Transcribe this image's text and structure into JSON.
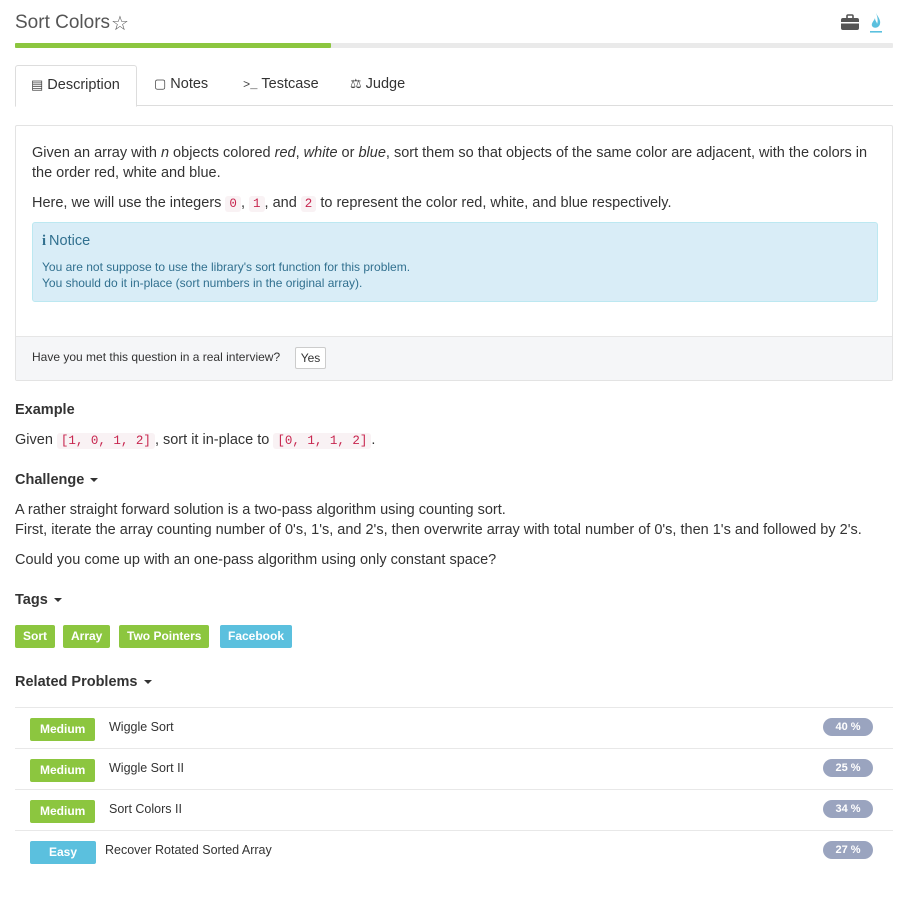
{
  "header": {
    "title": "Sort Colors",
    "progress_percent": 36
  },
  "tabs": [
    {
      "label": "Description",
      "icon": "document-icon",
      "active": true
    },
    {
      "label": "Notes",
      "icon": "note-icon",
      "active": false
    },
    {
      "label": "Testcase",
      "icon": "terminal-icon",
      "active": false
    },
    {
      "label": "Judge",
      "icon": "scales-icon",
      "active": false
    }
  ],
  "description": {
    "p1_a": "Given an array with ",
    "p1_n": "n",
    "p1_b": " objects colored ",
    "p1_red": "red",
    "p1_c": ", ",
    "p1_white": "white",
    "p1_d": " or ",
    "p1_blue": "blue",
    "p1_e": ", sort them so that objects of the same color are adjacent, with the colors in the order red, white and blue.",
    "p2_a": "Here, we will use the integers ",
    "p2_code0": "0",
    "p2_sep1": ", ",
    "p2_code1": "1",
    "p2_sep2": ", and ",
    "p2_code2": "2",
    "p2_b": " to represent the color red, white, and blue respectively."
  },
  "notice": {
    "icon": "i",
    "title": "Notice",
    "line1": "You are not suppose to use the library's sort function for this problem.",
    "line2": "You should do it in-place (sort numbers in the original array)."
  },
  "interview": {
    "question": "Have you met this question in a real interview?",
    "yes_label": "Yes"
  },
  "example": {
    "heading": "Example",
    "text_a": "Given ",
    "code_a": "[1, 0, 1, 2]",
    "text_b": ", sort it in-place to ",
    "code_b": "[0, 1, 1, 2]",
    "text_c": "."
  },
  "challenge": {
    "heading": "Challenge",
    "line1": "A rather straight forward solution is a two-pass algorithm using counting sort.",
    "line2": "First, iterate the array counting number of 0's, 1's, and 2's, then overwrite array with total number of 0's, then 1's and followed by 2's.",
    "line3": "Could you come up with an one-pass algorithm using only constant space?"
  },
  "tags": {
    "heading": "Tags",
    "items": [
      {
        "label": "Sort",
        "color": "#8cc63f"
      },
      {
        "label": "Array",
        "color": "#8cc63f"
      },
      {
        "label": "Two Pointers",
        "color": "#8cc63f"
      },
      {
        "label": "Facebook",
        "color": "#5bc0de"
      }
    ]
  },
  "related": {
    "heading": "Related Problems",
    "items": [
      {
        "difficulty": "Medium",
        "name": "Wiggle Sort",
        "percent": "40 %"
      },
      {
        "difficulty": "Medium",
        "name": "Wiggle Sort II",
        "percent": "25 %"
      },
      {
        "difficulty": "Medium",
        "name": "Sort Colors II",
        "percent": "34 %"
      },
      {
        "difficulty": "Easy",
        "name": "Recover Rotated Sorted Array",
        "percent": "27 %"
      }
    ]
  },
  "colors": {
    "accent_green": "#8cc63f",
    "accent_blue": "#5bc0de",
    "notice_bg": "#d9edf7",
    "percent_badge": "#9aa4bf"
  }
}
